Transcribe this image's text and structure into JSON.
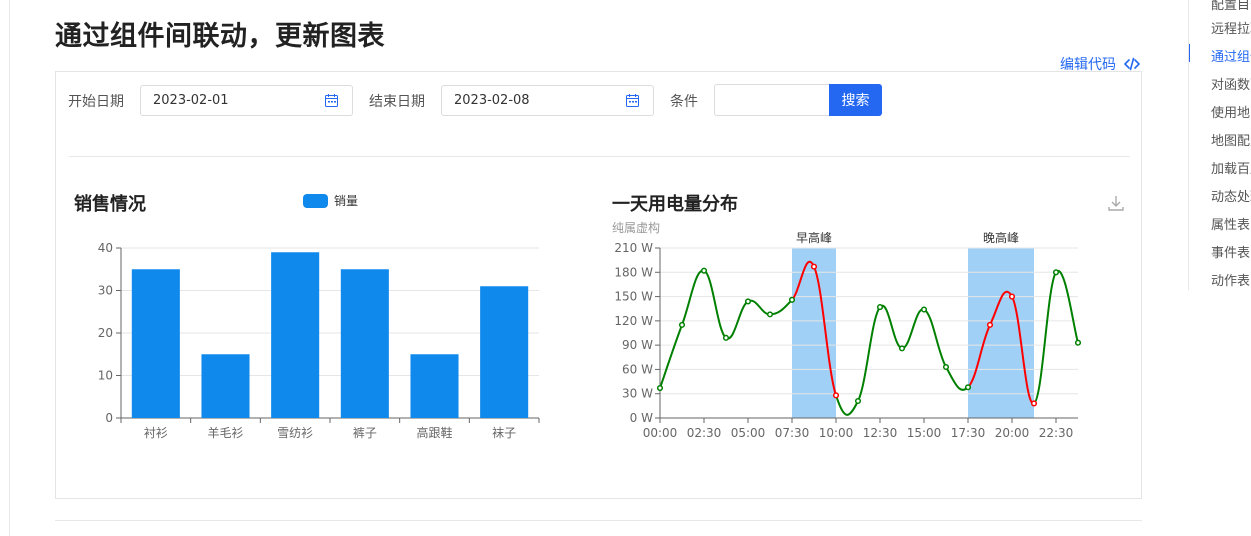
{
  "page": {
    "title": "通过组件间联动，更新图表",
    "edit_code": "编辑代码"
  },
  "form": {
    "start_label": "开始日期",
    "start_value": "2023-02-01",
    "end_label": "结束日期",
    "end_value": "2023-02-08",
    "cond_label": "条件",
    "cond_value": "",
    "search_label": "搜索"
  },
  "toc": {
    "items": [
      "配置目录",
      "远程拉取",
      "通过组件",
      "对函数配",
      "使用地图",
      "地图配置",
      "加载百度",
      "动态处理",
      "属性表",
      "事件表",
      "动作表"
    ],
    "active_index": 2
  },
  "colors": {
    "accent": "#2468f2",
    "bar": "#1089ed",
    "line_green": "#008000",
    "line_red": "#ff0000",
    "band": "#a0d0f5"
  },
  "chart_data": [
    {
      "type": "bar",
      "title": "销售情况",
      "legend": "销量",
      "categories": [
        "衬衫",
        "羊毛衫",
        "雪纺衫",
        "裤子",
        "高跟鞋",
        "袜子"
      ],
      "values": [
        35,
        15,
        39,
        35,
        15,
        31
      ],
      "ylim": [
        0,
        40
      ],
      "yticks": [
        0,
        10,
        20,
        30,
        40
      ],
      "grid": true
    },
    {
      "type": "line",
      "title": "一天用电量分布",
      "subtitle": "纯属虚构",
      "x": [
        "00:00",
        "01:15",
        "02:30",
        "03:45",
        "05:00",
        "06:15",
        "07:30",
        "08:45",
        "10:00",
        "11:15",
        "12:30",
        "13:45",
        "15:00",
        "16:15",
        "17:30",
        "18:45",
        "20:00",
        "21:15",
        "22:30",
        "23:45"
      ],
      "values": [
        37,
        115,
        182,
        99,
        144,
        128,
        146,
        187,
        28,
        21,
        137,
        86,
        134,
        63,
        38,
        115,
        150,
        18,
        180,
        93
      ],
      "xticks": [
        "00:00",
        "02:30",
        "05:00",
        "07:30",
        "10:00",
        "12:30",
        "15:00",
        "17:30",
        "20:00",
        "22:30"
      ],
      "yticks": [
        "0 W",
        "30 W",
        "60 W",
        "90 W",
        "120 W",
        "150 W",
        "180 W",
        "210 W"
      ],
      "ylim": [
        0,
        210
      ],
      "mark_areas": [
        {
          "label": "早高峰",
          "from": "07:30",
          "to": "10:00"
        },
        {
          "label": "晚高峰",
          "from": "17:30",
          "to": "21:15"
        }
      ],
      "highlight_ranges": [
        {
          "from": "07:30",
          "to": "10:00",
          "color": "red"
        },
        {
          "from": "17:30",
          "to": "21:15",
          "color": "red"
        }
      ],
      "grid": true
    }
  ]
}
